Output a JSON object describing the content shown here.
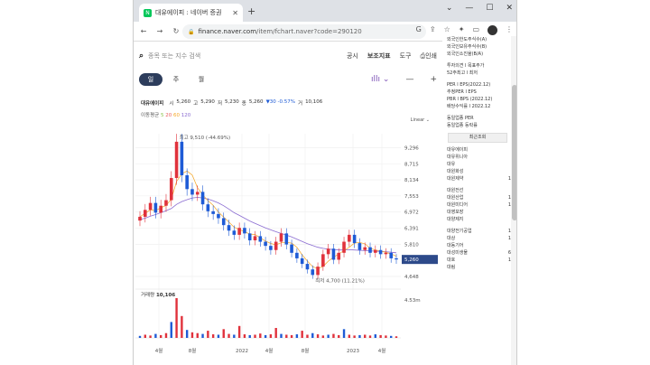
{
  "browser": {
    "tab_title": "대유에이피 : 네이버 증권",
    "favicon_text": "N",
    "url_host": "finance.naver.com",
    "url_path": "/item/fchart.naver?code=290120"
  },
  "page": {
    "search_placeholder": "종목 또는 지수 검색",
    "menu": [
      "공시",
      "보조지표",
      "도구",
      "인쇄"
    ],
    "periods": [
      "일",
      "주",
      "월"
    ],
    "scale_mode": "Linear",
    "stock_name": "대유에이피",
    "open_label": "시",
    "open": "5,260",
    "high_label": "고",
    "high": "5,290",
    "low_label": "저",
    "low": "5,230",
    "close_label": "종",
    "close": "5,260",
    "change": "▼30 -0.57%",
    "volume_label": "거",
    "volume": "10,106",
    "ma_label": "이동평균",
    "ma_periods": [
      "5",
      "20",
      "60",
      "120"
    ],
    "volume_title": "거래량",
    "volume_value": "10,106",
    "hi_annot": "최고 9,510 (-44.69%)",
    "lo_annot": "최저 4,700 (11.21%)"
  },
  "chart_data": {
    "type": "line",
    "price_ticks": [
      "9,296",
      "8,715",
      "8,134",
      "7,553",
      "6,972",
      "6,391",
      "5,810",
      "5,260",
      "4,648"
    ],
    "price_values": [
      9296,
      8715,
      8134,
      7553,
      6972,
      6391,
      5810,
      5260,
      4648
    ],
    "volume_tick": "4.53m",
    "x_labels": [
      "4월",
      "8월",
      "2022",
      "4월",
      "8월",
      "2023",
      "4월"
    ],
    "colors": {
      "up": "#e0323c",
      "down": "#1e5bd6",
      "ma5": "#8bc34a",
      "ma20": "#e85d5d",
      "ma60": "#f5a623",
      "ma120": "#8a6bd1",
      "price_tag": "#2d4a8a"
    },
    "series": [
      {
        "name": "종가",
        "values": [
          6800,
          7050,
          7300,
          6950,
          7200,
          7400,
          8200,
          9510,
          8300,
          7800,
          7600,
          7700,
          7250,
          7000,
          6900,
          6750,
          6500,
          6300,
          6150,
          6400,
          6200,
          5950,
          6100,
          5900,
          5750,
          5600,
          5900,
          6200,
          5800,
          5500,
          5300,
          5100,
          4900,
          4700,
          5000,
          5450,
          5650,
          5250,
          5500,
          5900,
          6150,
          5850,
          5600,
          5700,
          5500,
          5600,
          5450,
          5500,
          5300,
          5260
        ]
      },
      {
        "name": "120",
        "values": [
          6700,
          6750,
          6820,
          6880,
          6950,
          7020,
          7100,
          7250,
          7350,
          7420,
          7480,
          7500,
          7480,
          7440,
          7380,
          7300,
          7200,
          7080,
          6950,
          6850,
          6750,
          6650,
          6560,
          6480,
          6400,
          6330,
          6260,
          6200,
          6140,
          6070,
          5990,
          5910,
          5830,
          5760,
          5700,
          5660,
          5630,
          5620,
          5600,
          5600,
          5610,
          5600,
          5590,
          5580,
          5570,
          5560,
          5550,
          5540,
          5520,
          5500
        ]
      }
    ],
    "volume": [
      5,
      8,
      6,
      10,
      7,
      12,
      40,
      100,
      55,
      20,
      14,
      12,
      10,
      18,
      9,
      8,
      22,
      10,
      8,
      30,
      9,
      7,
      8,
      11,
      7,
      9,
      25,
      10,
      8,
      7,
      9,
      18,
      8,
      12,
      9,
      6,
      8,
      10,
      7,
      22,
      8,
      6,
      7,
      8,
      6,
      9,
      7,
      6,
      5,
      4
    ]
  },
  "sidebar": {
    "top": [
      "외국인한도주식수(A)",
      "외국인보유주식수(B)",
      "외국인소진율(B/A)",
      "투자의견 l 목표주가",
      "52주최고 l 최저",
      "PER l EPS(2022.12)",
      "추정PER l EPS",
      "PBR l BPS (2022.12)",
      "배당수익률 l 2022.12",
      "동일업종 PER",
      "동일업종 등락률"
    ],
    "recent_header": "최근조회",
    "items": [
      "대유에이피",
      "대유위니아",
      "대유",
      "대원화성",
      "대원제약",
      "대원전선",
      "대원산업",
      "대원미디어",
      "대영포장",
      "대양제지",
      "대양전기공업",
      "대상",
      "대동기어",
      "대성미생물",
      "대호",
      "대림"
    ],
    "counts": [
      "",
      "",
      "",
      "",
      "1",
      "",
      "1",
      "1",
      "",
      "",
      "1",
      "1",
      "",
      "6",
      "1",
      ""
    ]
  }
}
